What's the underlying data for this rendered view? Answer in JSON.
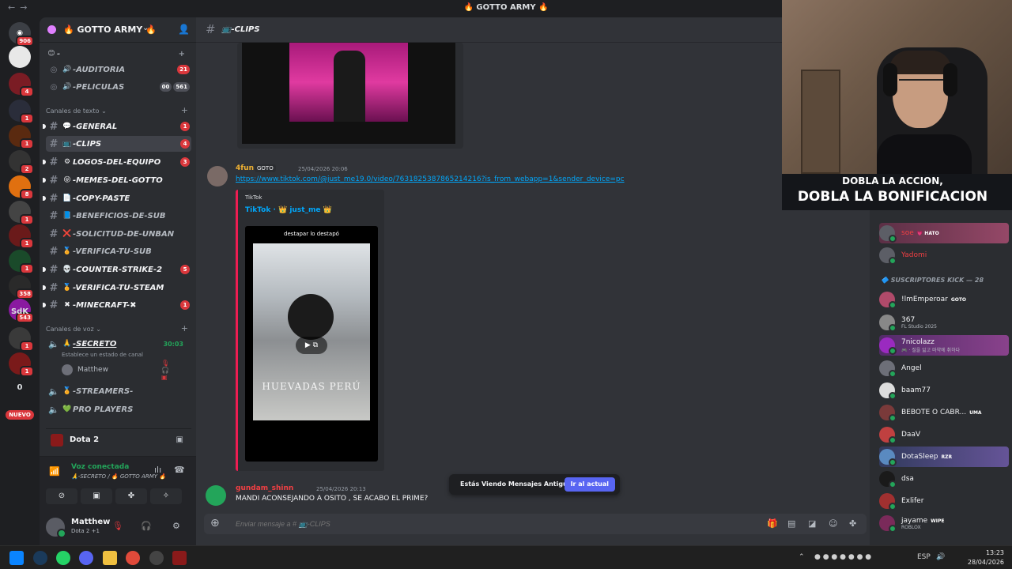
{
  "window": {
    "title": "🔥 GOTTO ARMY 🔥"
  },
  "rail": {
    "badges": [
      "906",
      "4",
      "1",
      "1",
      "2",
      "8",
      "1",
      "1",
      "1",
      "358",
      "1",
      "543",
      "1",
      "1"
    ],
    "text_items": [
      "SdK",
      "0"
    ],
    "new_label": "NUEVO"
  },
  "server": {
    "name": "🔥 GOTTO ARMY 🔥"
  },
  "sidebar": {
    "top_channels": [
      {
        "emoji": "😊",
        "label": "-"
      },
      {
        "emoji": "🔊",
        "label": "-AUDITORIA",
        "count": "21"
      },
      {
        "emoji": "🔊",
        "label": "-PELICULAS",
        "count_a": "00",
        "count_b": "561"
      }
    ],
    "text_category": "Canales de texto",
    "text_channels": [
      {
        "emoji": "💬",
        "label": "-GENERAL",
        "count": "1"
      },
      {
        "emoji": "📺",
        "label": "-CLIPS",
        "count": "4"
      },
      {
        "emoji": "⚙",
        "label": "LOGOS-DEL-EQUIPO",
        "count": "3"
      },
      {
        "emoji": "😝",
        "label": "-MEMES-DEL-GOTTO",
        "count": ""
      },
      {
        "emoji": "📄",
        "label": "-COPY-PASTE",
        "count": ""
      },
      {
        "emoji": "📘",
        "label": "-BENEFICIOS-DE-SUB",
        "count": ""
      },
      {
        "emoji": "❌",
        "label": "-SOLICITUD-DE-UNBAN",
        "count": ""
      },
      {
        "emoji": "🏅",
        "label": "-VERIFICA-TU-SUB",
        "count": ""
      },
      {
        "emoji": "💀",
        "label": "-COUNTER-STRIKE-2",
        "count": "5"
      },
      {
        "emoji": "🏅",
        "label": "-VERIFICA-TU-STEAM",
        "count": ""
      },
      {
        "emoji": "✖",
        "label": "-MINECRAFT-✖",
        "count": "1"
      }
    ],
    "voice_category": "Canales de voz",
    "voice_channels": [
      {
        "emoji": "🙏",
        "label": "-SECRETO",
        "timer": "30:03"
      },
      {
        "emoji": "🏅",
        "label": "-STREAMERS-"
      },
      {
        "emoji": "💚",
        "label": "PRO PLAYERS"
      }
    ],
    "voice_status": "Establece un estado de canal",
    "voice_user": "Matthew"
  },
  "activity": {
    "game": "Dota 2"
  },
  "voice_panel": {
    "status": "Voz conectada",
    "location": "🙏-SECRETO / 🔥 GOTTO ARMY 🔥"
  },
  "user": {
    "name": "Matthew",
    "status": "Dota 2 +1"
  },
  "channel": {
    "name": "📺-CLIPS"
  },
  "messages": {
    "m1": {
      "author": "4fun",
      "tag": "GOTO",
      "time": "25/04/2026 20:06",
      "link": "https://www.tiktok.com/@just_me19.0/video/7631825387865214216?is_from_webapp=1&sender_device=pc",
      "embed_provider": "TikTok",
      "embed_title": "TikTok · 👑 just_me 👑",
      "video_caption": "destapar lo destapó",
      "video_overlay": "HUEVADAS PERÚ"
    },
    "m2": {
      "author": "gundam_shinn",
      "time": "25/04/2026 20:13",
      "text": "MANDI ACONSEJANDO A OSITO , SE ACABO EL PRIME?"
    }
  },
  "old_messages": {
    "text": "Estás Viendo Mensajes Antiguos",
    "button": "Ir al actual"
  },
  "composer": {
    "placeholder": "Enviar mensaje a # 📺-CLIPS"
  },
  "stream_overlay": {
    "line1": "DOBLA LA ACCION,",
    "line2": "DOBLA LA BONIFICACION"
  },
  "members": {
    "top": [
      {
        "name": "soe",
        "tag": "💗 HATO"
      },
      {
        "name": "Yadomi"
      }
    ],
    "category": "SUSCRIPTORES KICK — 28",
    "list": [
      {
        "name": "!lmEmperoar",
        "tag": "GOTO"
      },
      {
        "name": "367",
        "sub": "FL Studio 2025"
      },
      {
        "name": "7nicolazz",
        "sub": "🎮 · 질을 잃고 마약에 취하다"
      },
      {
        "name": "Angel"
      },
      {
        "name": "baam77"
      },
      {
        "name": "BEBOTE O CABR...",
        "tag": "UMA"
      },
      {
        "name": "DaaV"
      },
      {
        "name": "DotaSleep",
        "tag": "RZR"
      },
      {
        "name": "dsa"
      },
      {
        "name": "Exlifer"
      },
      {
        "name": "jayame",
        "tag": "WIPE",
        "sub": "ROBLOX"
      }
    ]
  },
  "taskbar": {
    "lang": "ESP",
    "time": "13:23",
    "date": "28/04/2026"
  },
  "colors": {
    "accent": "#5865f2",
    "danger": "#da373c",
    "online": "#23a55a",
    "link": "#00a8fc"
  }
}
